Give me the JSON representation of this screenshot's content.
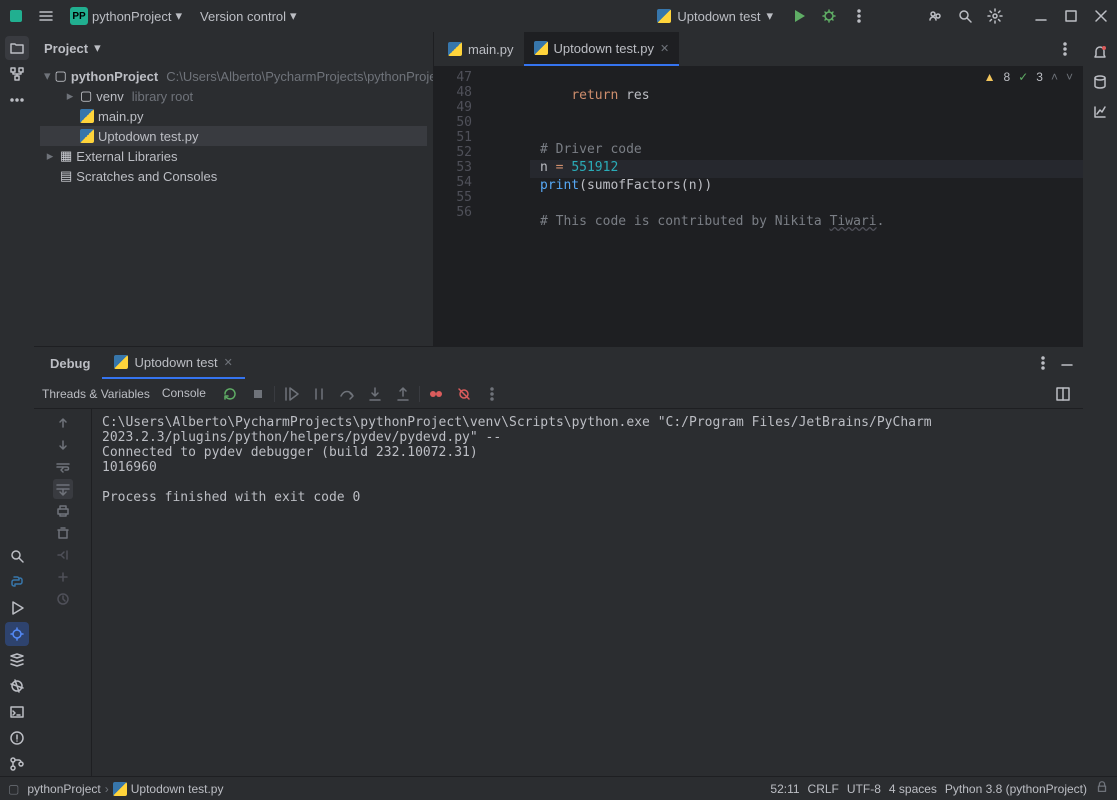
{
  "titlebar": {
    "project_badge": "PP",
    "project_name": "pythonProject",
    "version_control": "Version control",
    "run_config": "Uptodown test"
  },
  "project": {
    "title": "Project",
    "root": "pythonProject",
    "root_path": "C:\\Users\\Alberto\\PycharmProjects\\pythonProject",
    "venv": "venv",
    "venv_hint": "library root",
    "file1": "main.py",
    "file2": "Uptodown test.py",
    "external": "External Libraries",
    "scratches": "Scratches and Consoles"
  },
  "tabs": {
    "tab1": "main.py",
    "tab2": "Uptodown test.py"
  },
  "inspection": {
    "warnings": "8",
    "checks": "3"
  },
  "code": {
    "lines": [
      "47",
      "48",
      "49",
      "50",
      "51",
      "52",
      "53",
      "54",
      "55",
      "56"
    ],
    "l48a": "return",
    "l48b": " res",
    "l51": "# Driver code",
    "l52a": "n ",
    "l52b": "=",
    "l52c": " ",
    "l52d": "551912",
    "l53a": "print",
    "l53b": "(sumofFactors(n))",
    "l55a": "# This code is contributed by Nikita ",
    "l55b": "Tiwari",
    "l55c": "."
  },
  "debug": {
    "title": "Debug",
    "tab": "Uptodown test",
    "sub_threads": "Threads & Variables",
    "sub_console": "Console",
    "output_l1": "C:\\Users\\Alberto\\PycharmProjects\\pythonProject\\venv\\Scripts\\python.exe \"C:/Program Files/JetBrains/PyCharm 2023.2.3/plugins/python/helpers/pydev/pydevd.py\" --",
    "output_l2": "Connected to pydev debugger (build 232.10072.31)",
    "output_l3": "1016960",
    "output_l4": "",
    "output_l5": "Process finished with exit code 0"
  },
  "status": {
    "crumb1": "pythonProject",
    "crumb2": "Uptodown test.py",
    "pos": "52:11",
    "eol": "CRLF",
    "enc": "UTF-8",
    "indent": "4 spaces",
    "interp": "Python 3.8 (pythonProject)"
  }
}
